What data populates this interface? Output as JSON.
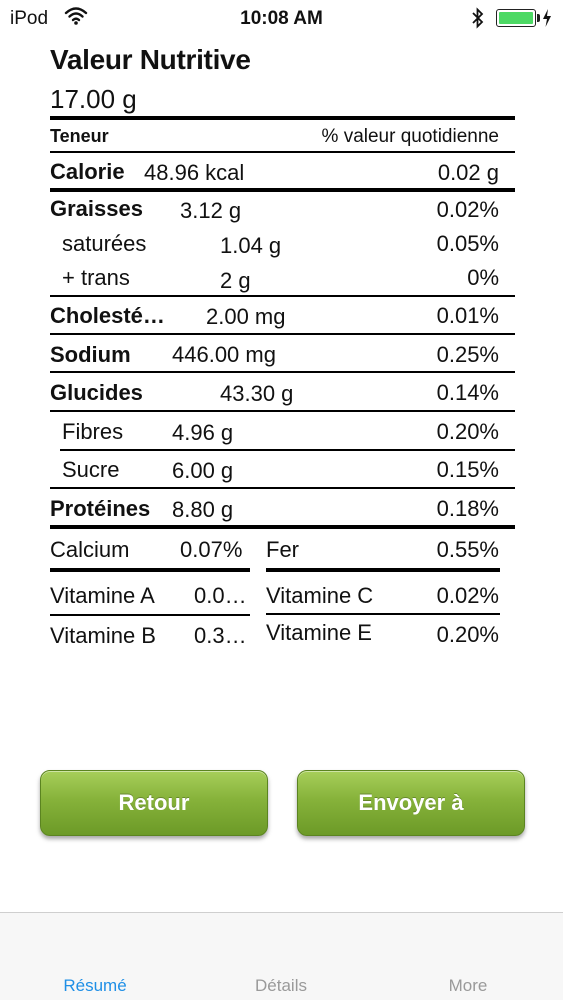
{
  "status_bar": {
    "carrier": "iPod",
    "time": "10:08 AM",
    "battery_color": "#4cd964"
  },
  "nutrition": {
    "title": "Valeur Nutritive",
    "serving": "17.00 g",
    "header_left": "Teneur",
    "header_right": "% valeur quotidienne",
    "calorie": {
      "label": "Calorie",
      "value": "48.96 kcal",
      "dv": "0.02 g"
    },
    "graisses": {
      "label": "Graisses",
      "value": "3.12 g",
      "dv": "0.02%"
    },
    "saturees": {
      "label": "saturées",
      "value": "1.04 g",
      "dv": "0.05%"
    },
    "trans": {
      "label": "+ trans",
      "value": "2 g",
      "dv": "0%"
    },
    "cholesterol": {
      "label": "Cholesté…",
      "value": "2.00 mg",
      "dv": "0.01%"
    },
    "sodium": {
      "label": "Sodium",
      "value": "446.00 mg",
      "dv": "0.25%"
    },
    "glucides": {
      "label": "Glucides",
      "value": "43.30 g",
      "dv": "0.14%"
    },
    "fibres": {
      "label": "Fibres",
      "value": "4.96 g",
      "dv": "0.20%"
    },
    "sucre": {
      "label": "Sucre",
      "value": "6.00 g",
      "dv": "0.15%"
    },
    "proteines": {
      "label": "Protéines",
      "value": "8.80 g",
      "dv": "0.18%"
    },
    "minerals": {
      "calcium": {
        "label": "Calcium",
        "value": "0.07%"
      },
      "fer": {
        "label": "Fer",
        "value": "0.55%"
      },
      "vitamine_a": {
        "label": "Vitamine A",
        "value": "0.0…"
      },
      "vitamine_c": {
        "label": "Vitamine C",
        "value": "0.02%"
      },
      "vitamine_b": {
        "label": "Vitamine B",
        "value": "0.3…"
      },
      "vitamine_e": {
        "label": "Vitamine E",
        "value": "0.20%"
      }
    }
  },
  "buttons": {
    "retour": "Retour",
    "envoyer": "Envoyer à"
  },
  "tabs": [
    {
      "label": "Résumé",
      "active": true
    },
    {
      "label": "Détails",
      "active": false
    },
    {
      "label": "More",
      "active": false
    }
  ],
  "colors": {
    "button_green": "#86b23a",
    "tab_active": "#1f8fe6",
    "tab_inactive": "#9a9a9a"
  },
  "icons": [
    "wifi-icon",
    "bluetooth-icon",
    "battery-icon",
    "charging-bolt-icon"
  ]
}
